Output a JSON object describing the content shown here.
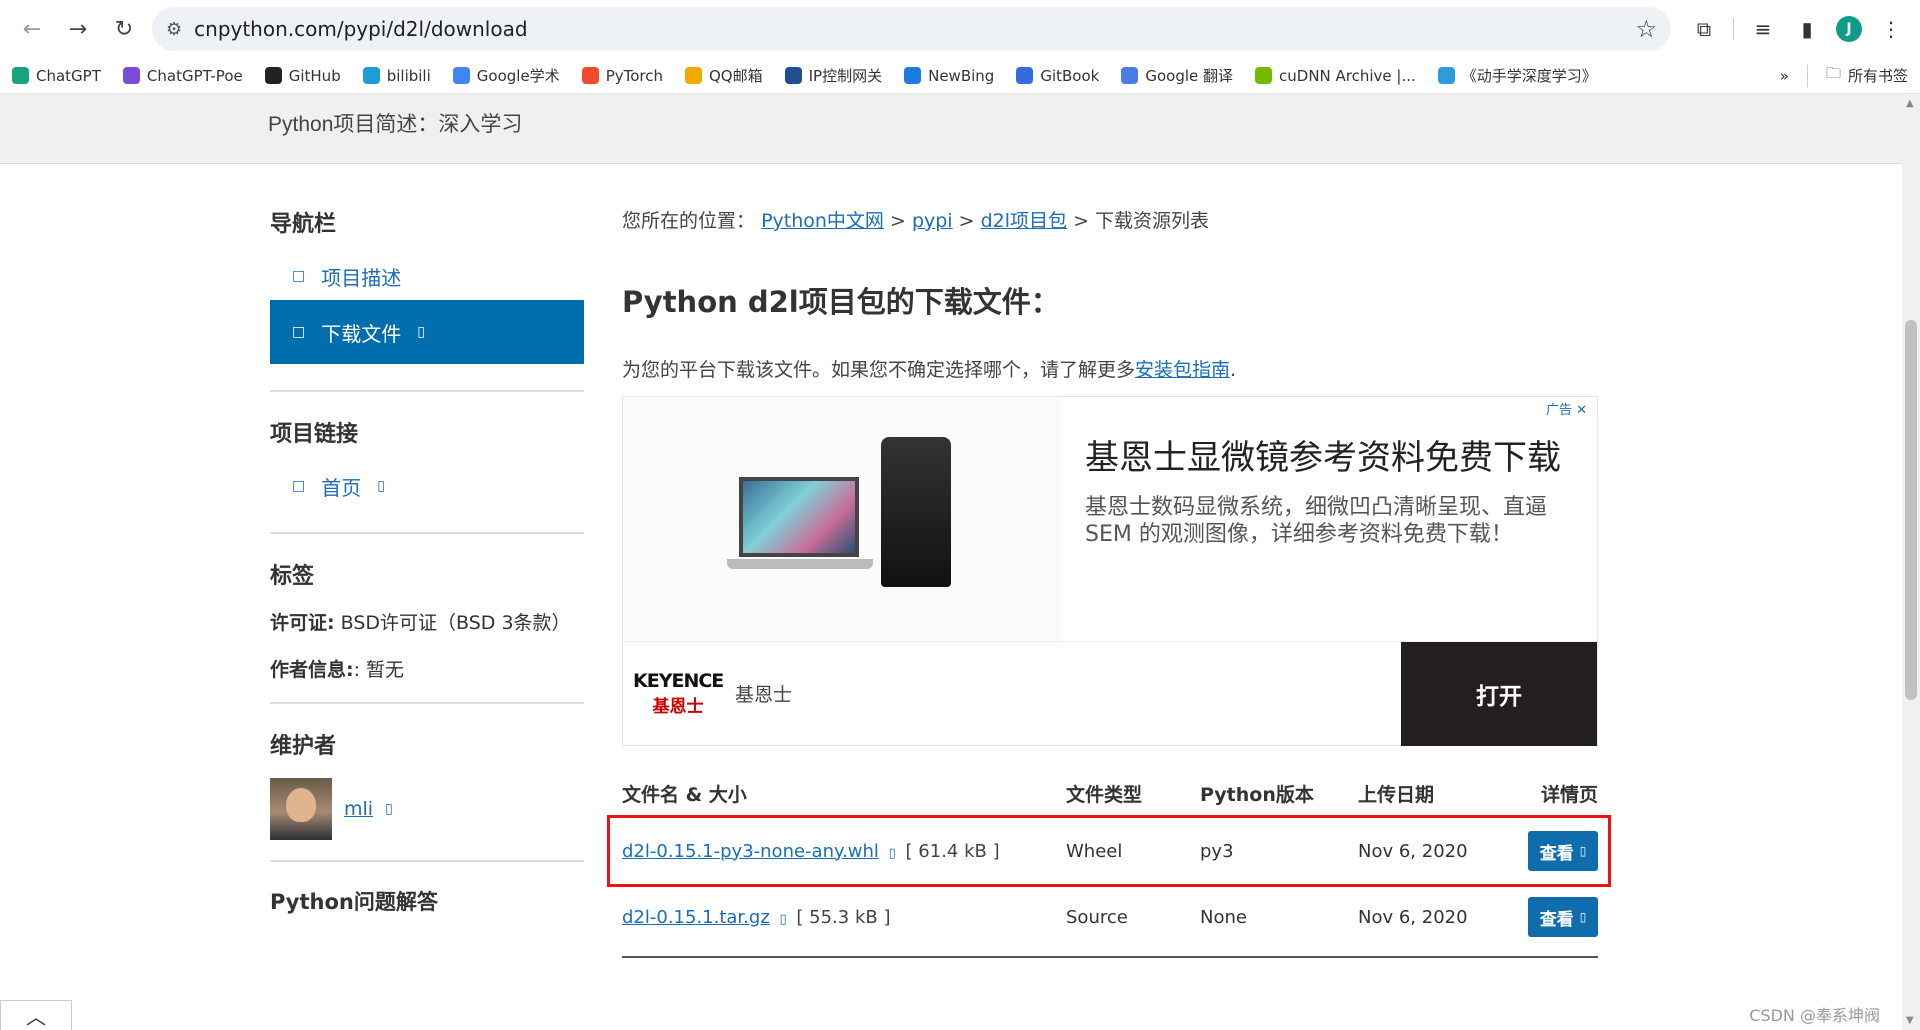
{
  "browser": {
    "url": "cnpython.com/pypi/d2l/download",
    "bookmarks": [
      {
        "label": "ChatGPT",
        "icon": "chatgpt-icon",
        "color": "#19a37f"
      },
      {
        "label": "ChatGPT-Poe",
        "icon": "poe-icon",
        "color": "#7b4cd6"
      },
      {
        "label": "GitHub",
        "icon": "github-icon",
        "color": "#222222"
      },
      {
        "label": "bilibili",
        "icon": "bilibili-icon",
        "color": "#1f9bd6"
      },
      {
        "label": "Google学术",
        "icon": "google-scholar-icon",
        "color": "#4285f4"
      },
      {
        "label": "PyTorch",
        "icon": "pytorch-icon",
        "color": "#ee4c2c"
      },
      {
        "label": "QQ邮箱",
        "icon": "qqmail-icon",
        "color": "#f2a900"
      },
      {
        "label": "IP控制网关",
        "icon": "ip-gateway-icon",
        "color": "#1d4f91"
      },
      {
        "label": "NewBing",
        "icon": "bing-icon",
        "color": "#1f7ae0"
      },
      {
        "label": "GitBook",
        "icon": "gitbook-icon",
        "color": "#346ddb"
      },
      {
        "label": "Google 翻译",
        "icon": "google-translate-icon",
        "color": "#4b7be5"
      },
      {
        "label": "cuDNN Archive |...",
        "icon": "nvidia-icon",
        "color": "#76b900"
      },
      {
        "label": "《动手学深度学习》",
        "icon": "d2l-icon",
        "color": "#2f9bd8"
      }
    ],
    "all_bookmarks_label": "所有书签",
    "profile_initial": "J"
  },
  "page": {
    "header_subtitle": "Python项目简述：深入学习",
    "sidebar": {
      "nav_heading": "导航栏",
      "nav_items": [
        {
          "label": "项目描述",
          "icon": "□"
        },
        {
          "label": "下载文件",
          "icon": "□",
          "suffix": "▯"
        }
      ],
      "links_heading": "项目链接",
      "links": [
        {
          "label": "首页",
          "icon": "□",
          "suffix": "▯"
        }
      ],
      "tags_heading": "标签",
      "license_label": "许可证:",
      "license_value": " BSD许可证（BSD 3条款）",
      "author_label": "作者信息:",
      "author_value": ": 暂无",
      "maintainers_heading": "维护者",
      "maintainer_name": "mli",
      "maintainer_suffix": "▯",
      "qa_heading": "Python问题解答"
    },
    "main": {
      "crumb_prefix": "您所在的位置：",
      "crumbs": [
        "Python中文网",
        "pypi",
        "d2l项目包"
      ],
      "crumb_current": "下载资源列表",
      "crumb_sep": " > ",
      "title": "Python d2l项目包的下载文件：",
      "lead_text": "为您的平台下载该文件。如果您不确定选择哪个，请了解更多",
      "lead_link": "安装包指南",
      "lead_end": "."
    },
    "ad": {
      "label": "广告",
      "close": "✕",
      "title": "基恩士显微镜参考资料免费下载",
      "description": "基恩士数码显微系统，细微凹凸清晰呈现、直逼SEM 的观测图像，详细参考资料免费下载！",
      "logo_en": "KEYENCE",
      "logo_cn": "基恩士",
      "brand": "基恩士",
      "cta": "打开"
    },
    "downloads": {
      "headers": [
        "文件名 & 大小",
        "文件类型",
        "Python版本",
        "上传日期",
        "详情页"
      ],
      "rows": [
        {
          "file": "d2l-0.15.1-py3-none-any.whl",
          "icon": "▯",
          "size": "[ 61.4 kB ]",
          "type": "Wheel",
          "python": "py3",
          "date": "Nov 6, 2020",
          "action": "查看",
          "action_icon": "▯"
        },
        {
          "file": "d2l-0.15.1.tar.gz",
          "icon": "▯",
          "size": "[ 55.3 kB ]",
          "type": "Source",
          "python": "None",
          "date": "Nov 6, 2020",
          "action": "查看",
          "action_icon": "▯"
        }
      ]
    },
    "watermark": "CSDN @奉系坤阀",
    "scroll_top_icon": "︿"
  }
}
